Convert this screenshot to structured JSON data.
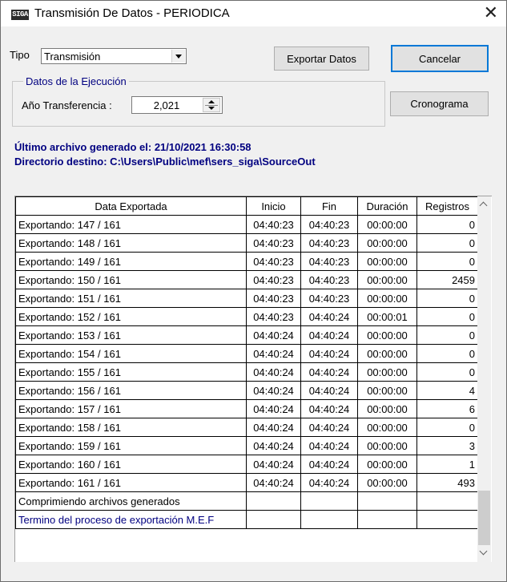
{
  "window": {
    "title": "Transmisión De Datos - PERIODICA",
    "icon_text": "SIGA",
    "close_glyph": "✕"
  },
  "toolbar": {
    "tipo_label": "Tipo",
    "tipo_value": "Transmisión",
    "export_button": "Exportar Datos",
    "cancel_button": "Cancelar"
  },
  "execution": {
    "group_title": "Datos de la Ejecución",
    "year_label": "Año Transferencia :",
    "year_value": "2,021",
    "schedule_button": "Cronograma"
  },
  "info": {
    "last_file": "Último archivo generado el: 21/10/2021 16:30:58",
    "destination": "Directorio destino: C:\\Users\\Public\\mef\\sers_siga\\SourceOut"
  },
  "grid": {
    "columns": [
      "Data Exportada",
      "Inicio",
      "Fin",
      "Duración",
      "Registros"
    ],
    "rows": [
      [
        "Exportando: 147 / 161",
        "04:40:23",
        "04:40:23",
        "00:00:00",
        "0"
      ],
      [
        "Exportando: 148 / 161",
        "04:40:23",
        "04:40:23",
        "00:00:00",
        "0"
      ],
      [
        "Exportando: 149 / 161",
        "04:40:23",
        "04:40:23",
        "00:00:00",
        "0"
      ],
      [
        "Exportando: 150 / 161",
        "04:40:23",
        "04:40:23",
        "00:00:00",
        "2459"
      ],
      [
        "Exportando: 151 / 161",
        "04:40:23",
        "04:40:23",
        "00:00:00",
        "0"
      ],
      [
        "Exportando: 152 / 161",
        "04:40:23",
        "04:40:24",
        "00:00:01",
        "0"
      ],
      [
        "Exportando: 153 / 161",
        "04:40:24",
        "04:40:24",
        "00:00:00",
        "0"
      ],
      [
        "Exportando: 154 / 161",
        "04:40:24",
        "04:40:24",
        "00:00:00",
        "0"
      ],
      [
        "Exportando: 155 / 161",
        "04:40:24",
        "04:40:24",
        "00:00:00",
        "0"
      ],
      [
        "Exportando: 156 / 161",
        "04:40:24",
        "04:40:24",
        "00:00:00",
        "4"
      ],
      [
        "Exportando: 157 / 161",
        "04:40:24",
        "04:40:24",
        "00:00:00",
        "6"
      ],
      [
        "Exportando: 158 / 161",
        "04:40:24",
        "04:40:24",
        "00:00:00",
        "0"
      ],
      [
        "Exportando: 159 / 161",
        "04:40:24",
        "04:40:24",
        "00:00:00",
        "3"
      ],
      [
        "Exportando: 160 / 161",
        "04:40:24",
        "04:40:24",
        "00:00:00",
        "1"
      ],
      [
        "Exportando: 161 / 161",
        "04:40:24",
        "04:40:24",
        "00:00:00",
        "493"
      ],
      [
        "Comprimiendo archivos generados",
        "",
        "",
        "",
        ""
      ],
      [
        "Termino del proceso de exportación M.E.F",
        "",
        "",
        "",
        ""
      ]
    ]
  },
  "colors": {
    "info_text": "#000080",
    "default_button_border": "#0078d7"
  }
}
